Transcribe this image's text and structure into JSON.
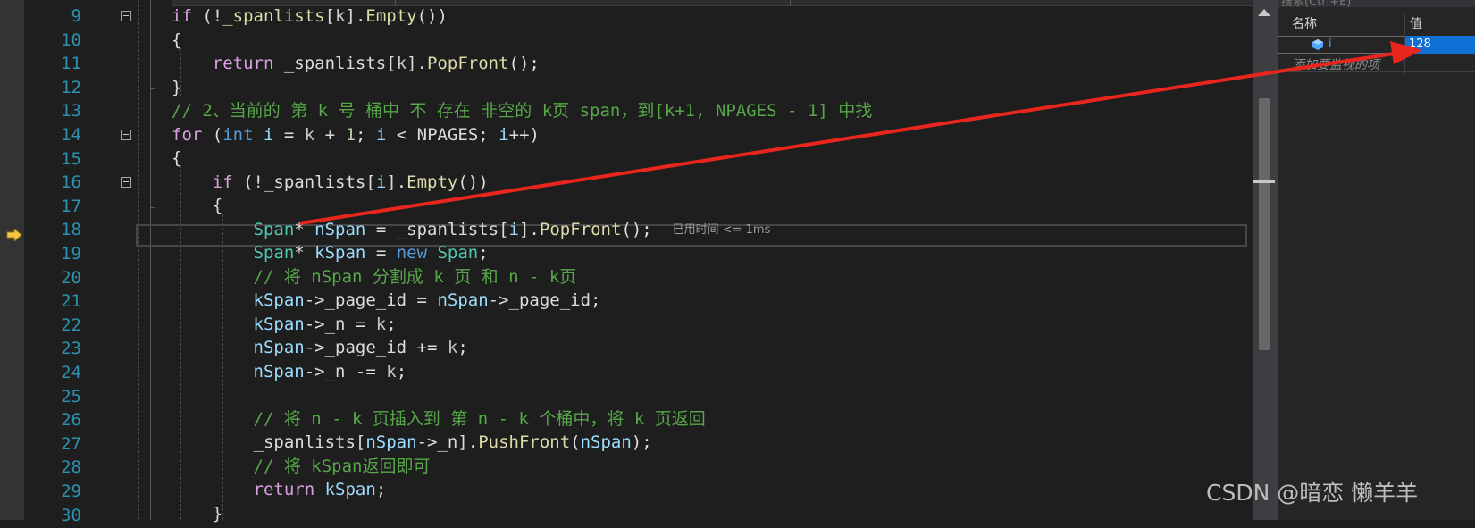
{
  "watch": {
    "search_placeholder": "搜索(Ctrl+E)",
    "columns": {
      "name": "名称",
      "value": "值"
    },
    "rows": [
      {
        "name": "i",
        "value": "128",
        "icon": "variable-icon"
      }
    ],
    "add_item_placeholder": "添加要监视的项"
  },
  "editor": {
    "current_line": "18",
    "elapsed_time": "已用时间 <= 1ms",
    "lines": [
      {
        "num": "9"
      },
      {
        "num": "10"
      },
      {
        "num": "11"
      },
      {
        "num": "12"
      },
      {
        "num": "13"
      },
      {
        "num": "14"
      },
      {
        "num": "15"
      },
      {
        "num": "16"
      },
      {
        "num": "17"
      },
      {
        "num": "18"
      },
      {
        "num": "19"
      },
      {
        "num": "20"
      },
      {
        "num": "21"
      },
      {
        "num": "22"
      },
      {
        "num": "23"
      },
      {
        "num": "24"
      },
      {
        "num": "25"
      },
      {
        "num": "26"
      },
      {
        "num": "27"
      },
      {
        "num": "28"
      },
      {
        "num": "29"
      },
      {
        "num": "30"
      }
    ]
  },
  "watermark": "CSDN @暗恋 懒羊羊",
  "colors": {
    "keyword": "#569cd6",
    "control": "#d8a0df",
    "function": "#dcdcaa",
    "type": "#4ec9b0",
    "variable": "#9cdcfe",
    "number": "#b5cea8",
    "comment": "#57a64a",
    "line_number": "#2b91af",
    "selected_value": "#0e6fd4",
    "annotation_arrow": "#e8261d",
    "exec_arrow": "#f3c746"
  }
}
